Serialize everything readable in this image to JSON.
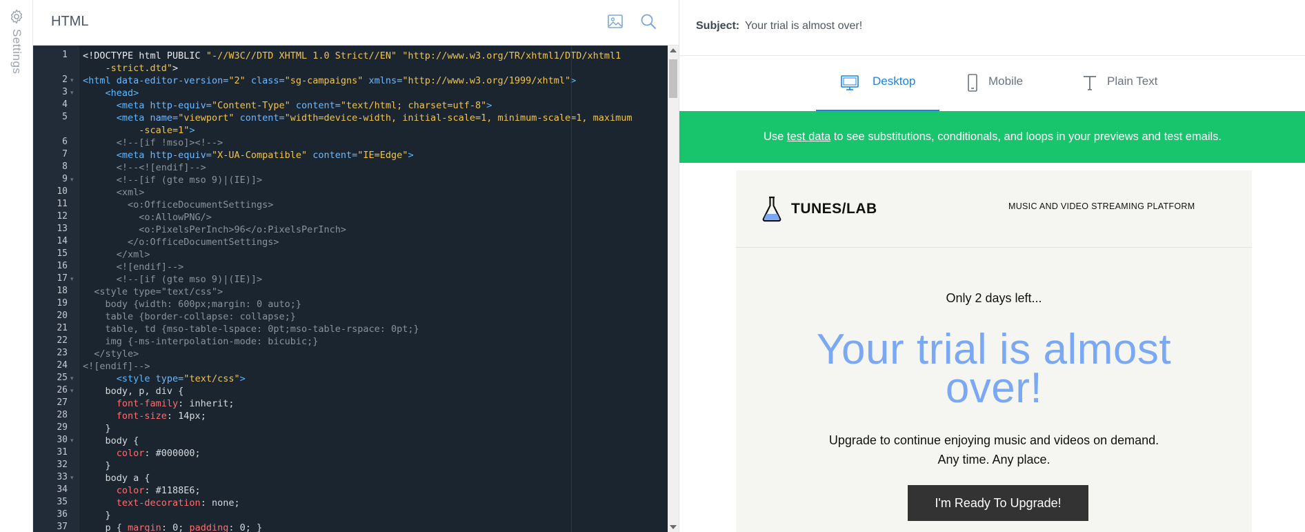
{
  "settings": {
    "label": "Settings"
  },
  "editor": {
    "title": "HTML",
    "lines": [
      {
        "n": "1",
        "fold": false,
        "segs": [
          [
            "dt",
            "<!DOCTYPE html PUBLIC "
          ],
          [
            "str",
            "\"-//W3C//DTD XHTML 1.0 Strict//EN\""
          ],
          [
            "dt",
            " "
          ],
          [
            "str",
            "\"http://www.w3.org/TR/xhtml1/DTD/xhtml1"
          ]
        ]
      },
      {
        "n": "",
        "fold": false,
        "segs": [
          [
            "str",
            "    -strict.dtd\""
          ],
          [
            "dt",
            ">"
          ]
        ]
      },
      {
        "n": "2",
        "fold": true,
        "segs": [
          [
            "tag",
            "<html"
          ],
          [
            "attr",
            " data-editor-version="
          ],
          [
            "str",
            "\"2\""
          ],
          [
            "attr",
            " class="
          ],
          [
            "str",
            "\"sg-campaigns\""
          ],
          [
            "attr",
            " xmlns="
          ],
          [
            "str",
            "\"http://www.w3.org/1999/xhtml\""
          ],
          [
            "tag",
            ">"
          ]
        ]
      },
      {
        "n": "3",
        "fold": true,
        "segs": [
          [
            "tag",
            "    <head>"
          ]
        ]
      },
      {
        "n": "4",
        "fold": false,
        "segs": [
          [
            "tag",
            "      <meta"
          ],
          [
            "attr",
            " http-equiv="
          ],
          [
            "str",
            "\"Content-Type\""
          ],
          [
            "attr",
            " content="
          ],
          [
            "str",
            "\"text/html; charset=utf-8\""
          ],
          [
            "tag",
            ">"
          ]
        ]
      },
      {
        "n": "5",
        "fold": false,
        "segs": [
          [
            "tag",
            "      <meta"
          ],
          [
            "attr",
            " name="
          ],
          [
            "str",
            "\"viewport\""
          ],
          [
            "attr",
            " content="
          ],
          [
            "str",
            "\"width=device-width, initial-scale=1, minimum-scale=1, maximum"
          ]
        ]
      },
      {
        "n": "",
        "fold": false,
        "segs": [
          [
            "str",
            "          -scale=1\""
          ],
          [
            "tag",
            ">"
          ]
        ]
      },
      {
        "n": "6",
        "fold": false,
        "segs": [
          [
            "cmt",
            "      <!--[if !mso]><!-->"
          ]
        ]
      },
      {
        "n": "7",
        "fold": false,
        "segs": [
          [
            "tag",
            "      <meta"
          ],
          [
            "attr",
            " http-equiv="
          ],
          [
            "str",
            "\"X-UA-Compatible\""
          ],
          [
            "attr",
            " content="
          ],
          [
            "str",
            "\"IE=Edge\""
          ],
          [
            "tag",
            ">"
          ]
        ]
      },
      {
        "n": "8",
        "fold": false,
        "segs": [
          [
            "cmt",
            "      <!--<![endif]-->"
          ]
        ]
      },
      {
        "n": "9",
        "fold": true,
        "segs": [
          [
            "cmt",
            "      <!--[if (gte mso 9)|(IE)]>"
          ]
        ]
      },
      {
        "n": "10",
        "fold": false,
        "segs": [
          [
            "cmt",
            "      <xml>"
          ]
        ]
      },
      {
        "n": "11",
        "fold": false,
        "segs": [
          [
            "cmt",
            "        <o:OfficeDocumentSettings>"
          ]
        ]
      },
      {
        "n": "12",
        "fold": false,
        "segs": [
          [
            "cmt",
            "          <o:AllowPNG/>"
          ]
        ]
      },
      {
        "n": "13",
        "fold": false,
        "segs": [
          [
            "cmt",
            "          <o:PixelsPerInch>96</o:PixelsPerInch>"
          ]
        ]
      },
      {
        "n": "14",
        "fold": false,
        "segs": [
          [
            "cmt",
            "        </o:OfficeDocumentSettings>"
          ]
        ]
      },
      {
        "n": "15",
        "fold": false,
        "segs": [
          [
            "cmt",
            "      </xml>"
          ]
        ]
      },
      {
        "n": "16",
        "fold": false,
        "segs": [
          [
            "cmt",
            "      <![endif]-->"
          ]
        ]
      },
      {
        "n": "17",
        "fold": true,
        "segs": [
          [
            "cmt",
            "      <!--[if (gte mso 9)|(IE)]>"
          ]
        ]
      },
      {
        "n": "18",
        "fold": false,
        "segs": [
          [
            "cmt",
            "  <style type=\"text/css\">"
          ]
        ]
      },
      {
        "n": "19",
        "fold": false,
        "segs": [
          [
            "cmt",
            "    body {width: 600px;margin: 0 auto;}"
          ]
        ]
      },
      {
        "n": "20",
        "fold": false,
        "segs": [
          [
            "cmt",
            "    table {border-collapse: collapse;}"
          ]
        ]
      },
      {
        "n": "21",
        "fold": false,
        "segs": [
          [
            "cmt",
            "    table, td {mso-table-lspace: 0pt;mso-table-rspace: 0pt;}"
          ]
        ]
      },
      {
        "n": "22",
        "fold": false,
        "segs": [
          [
            "cmt",
            "    img {-ms-interpolation-mode: bicubic;}"
          ]
        ]
      },
      {
        "n": "23",
        "fold": false,
        "segs": [
          [
            "cmt",
            "  </style>"
          ]
        ]
      },
      {
        "n": "24",
        "fold": false,
        "segs": [
          [
            "cmt",
            "<![endif]-->"
          ]
        ]
      },
      {
        "n": "25",
        "fold": true,
        "segs": [
          [
            "tag",
            "      <style"
          ],
          [
            "attr",
            " type="
          ],
          [
            "str",
            "\"text/css\""
          ],
          [
            "tag",
            ">"
          ]
        ]
      },
      {
        "n": "26",
        "fold": true,
        "segs": [
          [
            "plain",
            "    body, p, div {"
          ]
        ]
      },
      {
        "n": "27",
        "fold": false,
        "segs": [
          [
            "prop",
            "      font-family"
          ],
          [
            "plain",
            ": inherit;"
          ]
        ]
      },
      {
        "n": "28",
        "fold": false,
        "segs": [
          [
            "prop",
            "      font-size"
          ],
          [
            "plain",
            ": 14px;"
          ]
        ]
      },
      {
        "n": "29",
        "fold": false,
        "segs": [
          [
            "plain",
            "    }"
          ]
        ]
      },
      {
        "n": "30",
        "fold": true,
        "segs": [
          [
            "plain",
            "    body {"
          ]
        ]
      },
      {
        "n": "31",
        "fold": false,
        "segs": [
          [
            "prop",
            "      color"
          ],
          [
            "plain",
            ": #000000;"
          ]
        ]
      },
      {
        "n": "32",
        "fold": false,
        "segs": [
          [
            "plain",
            "    }"
          ]
        ]
      },
      {
        "n": "33",
        "fold": true,
        "segs": [
          [
            "plain",
            "    body a {"
          ]
        ]
      },
      {
        "n": "34",
        "fold": false,
        "segs": [
          [
            "prop",
            "      color"
          ],
          [
            "plain",
            ": #1188E6;"
          ]
        ]
      },
      {
        "n": "35",
        "fold": false,
        "segs": [
          [
            "prop",
            "      text-decoration"
          ],
          [
            "plain",
            ": none;"
          ]
        ]
      },
      {
        "n": "36",
        "fold": false,
        "segs": [
          [
            "plain",
            "    }"
          ]
        ]
      },
      {
        "n": "37",
        "fold": false,
        "segs": [
          [
            "plain",
            "    p { "
          ],
          [
            "prop",
            "margin"
          ],
          [
            "plain",
            ": 0; "
          ],
          [
            "prop",
            "padding"
          ],
          [
            "plain",
            ": 0; }"
          ]
        ]
      }
    ]
  },
  "preview": {
    "subject_label": "Subject:",
    "subject_value": "Your trial is almost over!",
    "tabs": [
      {
        "label": "Desktop",
        "icon": "monitor-icon",
        "active": true
      },
      {
        "label": "Mobile",
        "icon": "phone-icon",
        "active": false
      },
      {
        "label": "Plain Text",
        "icon": "text-icon",
        "active": false
      }
    ],
    "banner": {
      "prefix": "Use ",
      "link": "test data",
      "suffix": " to see substitutions, conditionals, and loops in your previews and test emails."
    },
    "email": {
      "brand": "TUNES/LAB",
      "tagline": "MUSIC AND VIDEO STREAMING PLATFORM",
      "eyebrow": "Only 2 days left...",
      "headline": "Your trial is almost over!",
      "body_line1": "Upgrade to continue enjoying music and videos on demand.",
      "body_line2": "Any time. Any place.",
      "cta": "I'm Ready To Upgrade!"
    }
  },
  "colors": {
    "accent": "#1a82e2",
    "banner": "#18c46c",
    "headline": "#7ba8f2",
    "editor_bg": "#1b2530"
  }
}
